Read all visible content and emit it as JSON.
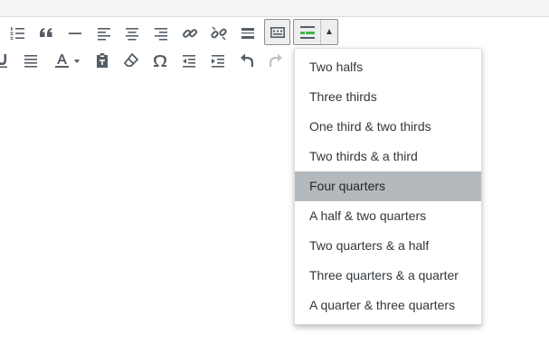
{
  "colors": {
    "selected_bg": "#b4b9be",
    "icon_color": "#555d66",
    "disabled_icon": "#c3c4c7",
    "layout_icon_accent": "#46b450"
  },
  "toolbar": {
    "row1": [
      {
        "name": "numbered-list-icon"
      },
      {
        "name": "blockquote-icon"
      },
      {
        "name": "horizontal-line-icon"
      },
      {
        "name": "align-left-icon"
      },
      {
        "name": "align-center-icon"
      },
      {
        "name": "align-right-icon"
      },
      {
        "name": "insert-link-icon"
      },
      {
        "name": "remove-link-icon"
      },
      {
        "name": "read-more-icon"
      },
      {
        "name": "toolbar-toggle-icon",
        "state": "active"
      },
      {
        "name": "column-layout-icon",
        "state": "open"
      }
    ],
    "row2": [
      {
        "name": "underline-icon"
      },
      {
        "name": "justify-icon"
      },
      {
        "name": "text-color-icon"
      },
      {
        "name": "paste-as-text-icon"
      },
      {
        "name": "clear-formatting-icon"
      },
      {
        "name": "special-character-icon"
      },
      {
        "name": "outdent-icon"
      },
      {
        "name": "indent-icon"
      },
      {
        "name": "undo-icon"
      },
      {
        "name": "redo-icon",
        "state": "disabled"
      }
    ]
  },
  "dropdown": {
    "items": [
      {
        "label": "Two halfs"
      },
      {
        "label": "Three thirds"
      },
      {
        "label": "One third & two thirds"
      },
      {
        "label": "Two thirds & a third"
      },
      {
        "label": "Four quarters",
        "selected": true
      },
      {
        "label": "A half & two quarters"
      },
      {
        "label": "Two quarters & a half"
      },
      {
        "label": "Three quarters & a quarter"
      },
      {
        "label": "A quarter & three quarters"
      }
    ]
  }
}
